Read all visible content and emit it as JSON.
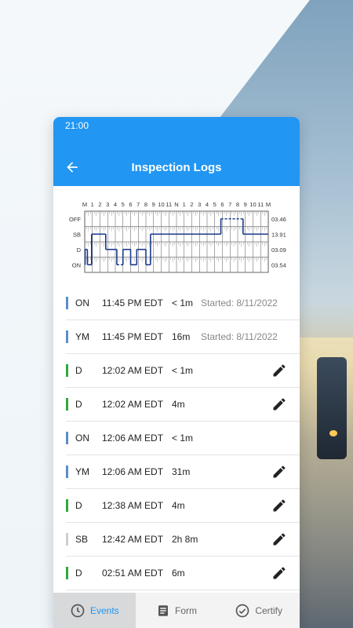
{
  "status_bar": {
    "time": "21:00"
  },
  "header": {
    "title": "Inspection Logs",
    "back_icon": "arrow-left-icon"
  },
  "chart": {
    "hour_labels": [
      "M",
      "1",
      "2",
      "3",
      "4",
      "5",
      "6",
      "7",
      "8",
      "9",
      "10",
      "11",
      "N",
      "1",
      "2",
      "3",
      "4",
      "5",
      "6",
      "7",
      "8",
      "9",
      "10",
      "11",
      "M"
    ],
    "row_labels": [
      "OFF",
      "SB",
      "D",
      "ON"
    ],
    "totals": [
      "03.46",
      "13.91",
      "03.09",
      "03.54"
    ],
    "line_color": "#1a3a8c"
  },
  "chart_data": {
    "type": "line",
    "x_unit": "hours since midnight",
    "status_levels": [
      "OFF",
      "SB",
      "D",
      "ON"
    ],
    "segments": [
      {
        "start": 0.0,
        "end": 0.05,
        "status": "ON"
      },
      {
        "start": 0.05,
        "end": 0.35,
        "status": "D"
      },
      {
        "start": 0.35,
        "end": 0.9,
        "status": "ON"
      },
      {
        "start": 0.9,
        "end": 2.75,
        "status": "SB"
      },
      {
        "start": 2.75,
        "end": 4.2,
        "status": "D"
      },
      {
        "start": 4.2,
        "end": 5.0,
        "status": "ON"
      },
      {
        "start": 5.0,
        "end": 6.0,
        "status": "D"
      },
      {
        "start": 6.0,
        "end": 6.8,
        "status": "ON"
      },
      {
        "start": 6.8,
        "end": 8.0,
        "status": "D"
      },
      {
        "start": 8.0,
        "end": 8.6,
        "status": "ON"
      },
      {
        "start": 8.6,
        "end": 17.8,
        "status": "SB"
      },
      {
        "start": 17.8,
        "end": 20.7,
        "status": "OFF"
      },
      {
        "start": 20.7,
        "end": 24.0,
        "status": "SB"
      }
    ],
    "dashed_ranges": [
      [
        4.2,
        5.0
      ],
      [
        17.8,
        20.7
      ]
    ]
  },
  "events": [
    {
      "status": "ON",
      "time": "11:45 PM EDT",
      "duration": "< 1m",
      "started": "Started: 8/11/2022",
      "color": "#5b8ec9",
      "editable": false
    },
    {
      "status": "YM",
      "time": "11:45 PM EDT",
      "duration": "16m",
      "started": "Started: 8/11/2022",
      "color": "#5b8ec9",
      "editable": false
    },
    {
      "status": "D",
      "time": "12:02 AM EDT",
      "duration": "< 1m",
      "started": "",
      "color": "#2eaa3c",
      "editable": true
    },
    {
      "status": "D",
      "time": "12:02 AM EDT",
      "duration": "4m",
      "started": "",
      "color": "#2eaa3c",
      "editable": true
    },
    {
      "status": "ON",
      "time": "12:06 AM EDT",
      "duration": "< 1m",
      "started": "",
      "color": "#5b8ec9",
      "editable": false
    },
    {
      "status": "YM",
      "time": "12:06 AM EDT",
      "duration": "31m",
      "started": "",
      "color": "#5b8ec9",
      "editable": true
    },
    {
      "status": "D",
      "time": "12:38 AM EDT",
      "duration": "4m",
      "started": "",
      "color": "#2eaa3c",
      "editable": true
    },
    {
      "status": "SB",
      "time": "12:42 AM EDT",
      "duration": "2h 8m",
      "started": "",
      "color": "#cfcfcf",
      "editable": true
    },
    {
      "status": "D",
      "time": "02:51 AM EDT",
      "duration": "6m",
      "started": "",
      "color": "#2eaa3c",
      "editable": true
    }
  ],
  "nav": {
    "events": {
      "label": "Events",
      "icon": "clock-icon"
    },
    "form": {
      "label": "Form",
      "icon": "document-icon"
    },
    "certify": {
      "label": "Certify",
      "icon": "check-circle-icon"
    }
  },
  "colors": {
    "accent": "#2196f3",
    "active_nav_bg": "#d7d9db"
  }
}
